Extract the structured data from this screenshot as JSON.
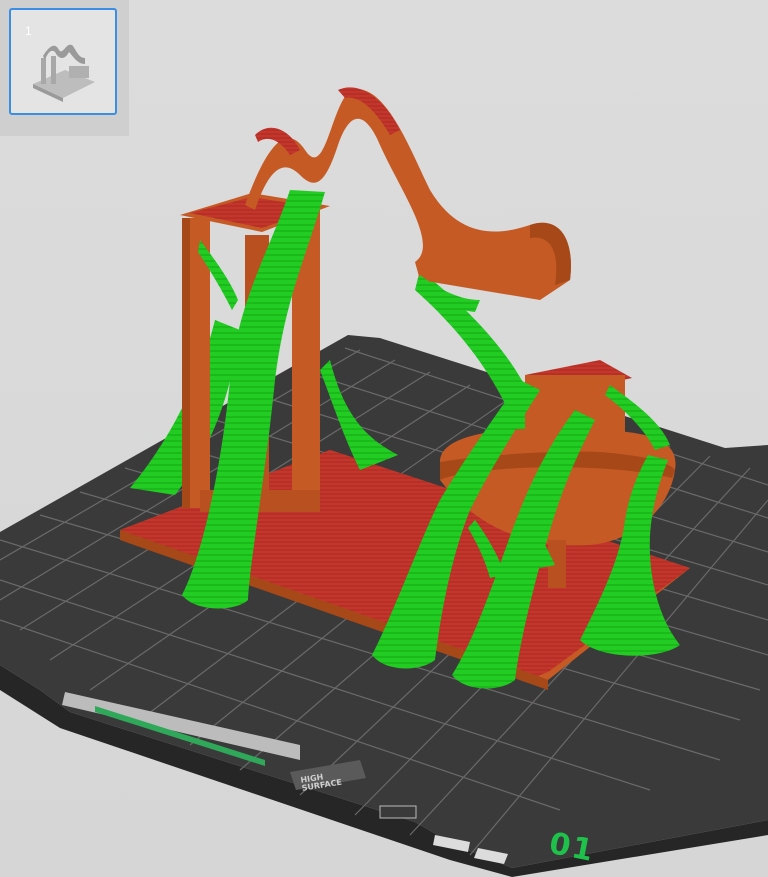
{
  "plate_list": {
    "items": [
      {
        "number": "1",
        "selected": true,
        "thumbnail_icon": "model-thumbnail-icon"
      }
    ]
  },
  "viewport": {
    "plate_label": "01",
    "plate_brand": "HIGH\nSURFACE",
    "colors": {
      "background": "#d9d9d9",
      "plate": "#3a3a3a",
      "grid": "#6a6a6a",
      "model": "#c65a25",
      "model_top": "#c4352c",
      "support": "#1fcc1f",
      "selection": "#3a8ee6",
      "plate_label": "#1ec24a"
    }
  }
}
